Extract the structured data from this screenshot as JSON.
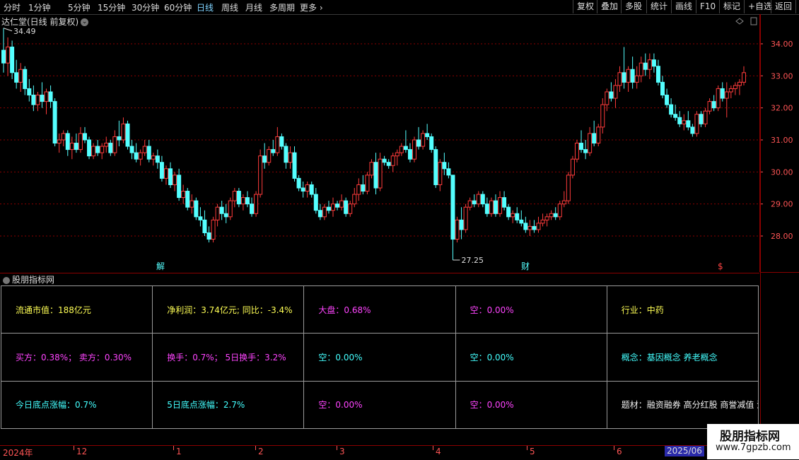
{
  "toolbar": {
    "periods": [
      "分时",
      "1分钟",
      "5分钟",
      "15分钟",
      "30分钟",
      "60分钟",
      "日线",
      "周线",
      "月线",
      "多周期",
      "更多"
    ],
    "right_buttons": [
      "复权",
      "叠加",
      "多股",
      "统计",
      "画线",
      "F10",
      "标记",
      "+自选",
      "返回"
    ]
  },
  "chart": {
    "title": "达仁堂(日线 前复权)",
    "y_ticks": [
      "34.00",
      "33.00",
      "32.00",
      "31.00",
      "30.00",
      "29.00",
      "28.00"
    ],
    "high_label": "34.49",
    "low_label": "27.25",
    "markers": {
      "jie": "解",
      "cai": "财",
      "dollar": "$"
    },
    "colors": {
      "up": "#ff3b3b",
      "down": "#54ffff",
      "grid": "#8b0000",
      "axis_text": "#ff5555"
    }
  },
  "candles": [
    {
      "o": 33.8,
      "h": 34.49,
      "l": 33.1,
      "c": 33.4
    },
    {
      "o": 33.4,
      "h": 34.2,
      "l": 33.0,
      "c": 33.9
    },
    {
      "o": 33.9,
      "h": 34.1,
      "l": 32.9,
      "c": 33.1
    },
    {
      "o": 33.1,
      "h": 33.5,
      "l": 32.6,
      "c": 32.8
    },
    {
      "o": 32.8,
      "h": 33.4,
      "l": 32.5,
      "c": 33.2
    },
    {
      "o": 33.2,
      "h": 33.3,
      "l": 32.4,
      "c": 32.6
    },
    {
      "o": 32.6,
      "h": 32.9,
      "l": 32.2,
      "c": 32.4
    },
    {
      "o": 32.4,
      "h": 32.7,
      "l": 31.9,
      "c": 32.1
    },
    {
      "o": 32.1,
      "h": 32.5,
      "l": 31.9,
      "c": 32.4
    },
    {
      "o": 32.4,
      "h": 32.8,
      "l": 32.0,
      "c": 32.2
    },
    {
      "o": 32.2,
      "h": 32.6,
      "l": 31.8,
      "c": 32.5
    },
    {
      "o": 32.5,
      "h": 32.7,
      "l": 32.0,
      "c": 32.2
    },
    {
      "o": 32.2,
      "h": 32.3,
      "l": 30.8,
      "c": 30.9
    },
    {
      "o": 30.9,
      "h": 31.2,
      "l": 30.6,
      "c": 31.0
    },
    {
      "o": 31.0,
      "h": 31.3,
      "l": 30.8,
      "c": 31.2
    },
    {
      "o": 31.2,
      "h": 31.3,
      "l": 30.5,
      "c": 30.7
    },
    {
      "o": 30.7,
      "h": 31.1,
      "l": 30.4,
      "c": 30.9
    },
    {
      "o": 30.9,
      "h": 31.2,
      "l": 30.6,
      "c": 30.7
    },
    {
      "o": 30.7,
      "h": 31.4,
      "l": 30.6,
      "c": 31.2
    },
    {
      "o": 31.2,
      "h": 31.4,
      "l": 30.9,
      "c": 31.0
    },
    {
      "o": 31.0,
      "h": 31.1,
      "l": 30.4,
      "c": 30.5
    },
    {
      "o": 30.5,
      "h": 30.9,
      "l": 30.4,
      "c": 30.8
    },
    {
      "o": 30.8,
      "h": 31.0,
      "l": 30.5,
      "c": 30.6
    },
    {
      "o": 30.6,
      "h": 30.9,
      "l": 30.4,
      "c": 30.8
    },
    {
      "o": 30.8,
      "h": 31.1,
      "l": 30.6,
      "c": 30.9
    },
    {
      "o": 30.9,
      "h": 31.0,
      "l": 30.5,
      "c": 30.6
    },
    {
      "o": 30.6,
      "h": 31.3,
      "l": 30.5,
      "c": 31.1
    },
    {
      "o": 31.1,
      "h": 31.6,
      "l": 30.8,
      "c": 31.0
    },
    {
      "o": 31.0,
      "h": 31.7,
      "l": 30.9,
      "c": 31.5
    },
    {
      "o": 31.5,
      "h": 31.6,
      "l": 30.7,
      "c": 30.8
    },
    {
      "o": 30.8,
      "h": 31.0,
      "l": 30.4,
      "c": 30.6
    },
    {
      "o": 30.6,
      "h": 30.9,
      "l": 30.3,
      "c": 30.4
    },
    {
      "o": 30.4,
      "h": 30.7,
      "l": 30.2,
      "c": 30.6
    },
    {
      "o": 30.6,
      "h": 31.0,
      "l": 30.5,
      "c": 30.8
    },
    {
      "o": 30.8,
      "h": 31.0,
      "l": 30.3,
      "c": 30.4
    },
    {
      "o": 30.4,
      "h": 30.6,
      "l": 30.2,
      "c": 30.5
    },
    {
      "o": 30.5,
      "h": 30.7,
      "l": 30.1,
      "c": 30.3
    },
    {
      "o": 30.3,
      "h": 30.5,
      "l": 29.7,
      "c": 29.8
    },
    {
      "o": 29.8,
      "h": 30.2,
      "l": 29.6,
      "c": 30.1
    },
    {
      "o": 30.1,
      "h": 30.3,
      "l": 29.5,
      "c": 29.6
    },
    {
      "o": 29.6,
      "h": 30.0,
      "l": 29.4,
      "c": 29.9
    },
    {
      "o": 29.9,
      "h": 30.1,
      "l": 29.1,
      "c": 29.2
    },
    {
      "o": 29.2,
      "h": 29.6,
      "l": 29.0,
      "c": 29.4
    },
    {
      "o": 29.4,
      "h": 29.5,
      "l": 28.8,
      "c": 28.9
    },
    {
      "o": 28.9,
      "h": 29.3,
      "l": 28.7,
      "c": 29.1
    },
    {
      "o": 29.1,
      "h": 29.2,
      "l": 28.5,
      "c": 28.6
    },
    {
      "o": 28.6,
      "h": 28.9,
      "l": 28.3,
      "c": 28.5
    },
    {
      "o": 28.5,
      "h": 28.8,
      "l": 28.0,
      "c": 28.1
    },
    {
      "o": 28.1,
      "h": 28.3,
      "l": 27.8,
      "c": 27.9
    },
    {
      "o": 27.9,
      "h": 28.6,
      "l": 27.8,
      "c": 28.5
    },
    {
      "o": 28.5,
      "h": 29.0,
      "l": 28.3,
      "c": 28.9
    },
    {
      "o": 28.9,
      "h": 29.1,
      "l": 28.5,
      "c": 28.7
    },
    {
      "o": 28.7,
      "h": 29.0,
      "l": 28.4,
      "c": 28.6
    },
    {
      "o": 28.6,
      "h": 29.2,
      "l": 28.5,
      "c": 29.1
    },
    {
      "o": 29.1,
      "h": 29.5,
      "l": 28.9,
      "c": 29.4
    },
    {
      "o": 29.4,
      "h": 29.5,
      "l": 28.9,
      "c": 29.0
    },
    {
      "o": 29.0,
      "h": 29.3,
      "l": 28.8,
      "c": 29.2
    },
    {
      "o": 29.2,
      "h": 29.4,
      "l": 28.9,
      "c": 29.0
    },
    {
      "o": 29.0,
      "h": 29.2,
      "l": 28.6,
      "c": 28.7
    },
    {
      "o": 28.7,
      "h": 29.4,
      "l": 28.6,
      "c": 29.3
    },
    {
      "o": 29.3,
      "h": 30.7,
      "l": 29.2,
      "c": 30.5
    },
    {
      "o": 30.5,
      "h": 30.9,
      "l": 30.1,
      "c": 30.3
    },
    {
      "o": 30.3,
      "h": 30.8,
      "l": 30.2,
      "c": 30.7
    },
    {
      "o": 30.7,
      "h": 31.0,
      "l": 30.5,
      "c": 30.6
    },
    {
      "o": 30.6,
      "h": 31.4,
      "l": 30.5,
      "c": 31.1
    },
    {
      "o": 31.1,
      "h": 31.2,
      "l": 30.7,
      "c": 30.8
    },
    {
      "o": 30.8,
      "h": 30.9,
      "l": 30.1,
      "c": 30.3
    },
    {
      "o": 30.3,
      "h": 30.8,
      "l": 30.1,
      "c": 30.6
    },
    {
      "o": 30.6,
      "h": 30.8,
      "l": 29.7,
      "c": 29.8
    },
    {
      "o": 29.8,
      "h": 29.9,
      "l": 29.4,
      "c": 29.5
    },
    {
      "o": 29.5,
      "h": 29.7,
      "l": 29.2,
      "c": 29.4
    },
    {
      "o": 29.4,
      "h": 29.7,
      "l": 29.2,
      "c": 29.6
    },
    {
      "o": 29.6,
      "h": 29.7,
      "l": 29.2,
      "c": 29.3
    },
    {
      "o": 29.3,
      "h": 29.5,
      "l": 28.7,
      "c": 28.8
    },
    {
      "o": 28.8,
      "h": 29.0,
      "l": 28.5,
      "c": 28.6
    },
    {
      "o": 28.6,
      "h": 29.0,
      "l": 28.5,
      "c": 28.9
    },
    {
      "o": 28.9,
      "h": 29.1,
      "l": 28.7,
      "c": 28.8
    },
    {
      "o": 28.8,
      "h": 29.2,
      "l": 28.6,
      "c": 29.0
    },
    {
      "o": 29.0,
      "h": 29.1,
      "l": 28.8,
      "c": 28.9
    },
    {
      "o": 28.9,
      "h": 29.3,
      "l": 28.8,
      "c": 29.1
    },
    {
      "o": 29.1,
      "h": 29.2,
      "l": 28.6,
      "c": 28.7
    },
    {
      "o": 28.7,
      "h": 29.1,
      "l": 28.6,
      "c": 29.0
    },
    {
      "o": 29.0,
      "h": 29.5,
      "l": 28.9,
      "c": 29.3
    },
    {
      "o": 29.3,
      "h": 29.8,
      "l": 29.1,
      "c": 29.6
    },
    {
      "o": 29.6,
      "h": 29.9,
      "l": 29.3,
      "c": 29.4
    },
    {
      "o": 29.4,
      "h": 30.0,
      "l": 29.3,
      "c": 29.9
    },
    {
      "o": 29.9,
      "h": 30.4,
      "l": 29.8,
      "c": 30.3
    },
    {
      "o": 30.3,
      "h": 30.6,
      "l": 29.3,
      "c": 29.5
    },
    {
      "o": 29.5,
      "h": 30.6,
      "l": 29.4,
      "c": 30.4
    },
    {
      "o": 30.4,
      "h": 30.5,
      "l": 30.2,
      "c": 30.3
    },
    {
      "o": 30.3,
      "h": 30.4,
      "l": 30.1,
      "c": 30.2
    },
    {
      "o": 30.2,
      "h": 30.6,
      "l": 30.0,
      "c": 30.5
    },
    {
      "o": 30.5,
      "h": 30.7,
      "l": 30.2,
      "c": 30.6
    },
    {
      "o": 30.6,
      "h": 30.9,
      "l": 30.5,
      "c": 30.8
    },
    {
      "o": 30.8,
      "h": 31.3,
      "l": 30.6,
      "c": 30.7
    },
    {
      "o": 30.7,
      "h": 30.9,
      "l": 30.3,
      "c": 30.4
    },
    {
      "o": 30.4,
      "h": 31.1,
      "l": 30.3,
      "c": 31.0
    },
    {
      "o": 31.0,
      "h": 31.4,
      "l": 30.7,
      "c": 30.8
    },
    {
      "o": 30.8,
      "h": 31.3,
      "l": 30.7,
      "c": 31.2
    },
    {
      "o": 31.2,
      "h": 31.5,
      "l": 31.0,
      "c": 31.1
    },
    {
      "o": 31.1,
      "h": 31.2,
      "l": 30.6,
      "c": 30.7
    },
    {
      "o": 30.7,
      "h": 30.8,
      "l": 29.5,
      "c": 29.6
    },
    {
      "o": 29.6,
      "h": 30.4,
      "l": 29.4,
      "c": 30.3
    },
    {
      "o": 30.3,
      "h": 30.6,
      "l": 29.9,
      "c": 30.1
    },
    {
      "o": 30.1,
      "h": 30.3,
      "l": 29.8,
      "c": 29.9
    },
    {
      "o": 29.9,
      "h": 29.9,
      "l": 27.25,
      "c": 27.9
    },
    {
      "o": 27.9,
      "h": 28.6,
      "l": 27.8,
      "c": 28.5
    },
    {
      "o": 28.5,
      "h": 28.9,
      "l": 27.9,
      "c": 28.2
    },
    {
      "o": 28.2,
      "h": 29.0,
      "l": 28.1,
      "c": 28.9
    },
    {
      "o": 28.9,
      "h": 29.2,
      "l": 28.8,
      "c": 29.1
    },
    {
      "o": 29.1,
      "h": 29.3,
      "l": 28.9,
      "c": 29.0
    },
    {
      "o": 29.0,
      "h": 29.4,
      "l": 28.9,
      "c": 29.3
    },
    {
      "o": 29.3,
      "h": 29.4,
      "l": 28.9,
      "c": 29.0
    },
    {
      "o": 29.0,
      "h": 29.2,
      "l": 28.6,
      "c": 28.7
    },
    {
      "o": 28.7,
      "h": 29.2,
      "l": 28.6,
      "c": 29.1
    },
    {
      "o": 29.1,
      "h": 29.3,
      "l": 28.6,
      "c": 28.7
    },
    {
      "o": 28.7,
      "h": 29.4,
      "l": 28.6,
      "c": 29.2
    },
    {
      "o": 29.2,
      "h": 29.4,
      "l": 28.8,
      "c": 28.9
    },
    {
      "o": 28.9,
      "h": 29.0,
      "l": 28.5,
      "c": 28.6
    },
    {
      "o": 28.6,
      "h": 28.8,
      "l": 28.4,
      "c": 28.7
    },
    {
      "o": 28.7,
      "h": 28.9,
      "l": 28.4,
      "c": 28.5
    },
    {
      "o": 28.5,
      "h": 28.8,
      "l": 28.3,
      "c": 28.4
    },
    {
      "o": 28.4,
      "h": 28.6,
      "l": 28.1,
      "c": 28.2
    },
    {
      "o": 28.2,
      "h": 28.5,
      "l": 28.0,
      "c": 28.3
    },
    {
      "o": 28.3,
      "h": 28.5,
      "l": 28.1,
      "c": 28.2
    },
    {
      "o": 28.2,
      "h": 28.6,
      "l": 28.1,
      "c": 28.4
    },
    {
      "o": 28.4,
      "h": 28.7,
      "l": 28.3,
      "c": 28.5
    },
    {
      "o": 28.5,
      "h": 28.7,
      "l": 28.3,
      "c": 28.6
    },
    {
      "o": 28.6,
      "h": 28.8,
      "l": 28.5,
      "c": 28.7
    },
    {
      "o": 28.7,
      "h": 28.9,
      "l": 28.5,
      "c": 28.6
    },
    {
      "o": 28.6,
      "h": 29.1,
      "l": 28.5,
      "c": 29.0
    },
    {
      "o": 29.0,
      "h": 29.4,
      "l": 28.9,
      "c": 29.1
    },
    {
      "o": 29.1,
      "h": 30.0,
      "l": 29.0,
      "c": 29.9
    },
    {
      "o": 29.9,
      "h": 30.5,
      "l": 29.8,
      "c": 30.4
    },
    {
      "o": 30.4,
      "h": 31.0,
      "l": 30.3,
      "c": 30.9
    },
    {
      "o": 30.9,
      "h": 31.3,
      "l": 30.6,
      "c": 30.7
    },
    {
      "o": 30.7,
      "h": 31.0,
      "l": 30.4,
      "c": 30.6
    },
    {
      "o": 30.6,
      "h": 31.4,
      "l": 30.5,
      "c": 31.2
    },
    {
      "o": 31.2,
      "h": 31.6,
      "l": 30.8,
      "c": 30.9
    },
    {
      "o": 30.9,
      "h": 31.5,
      "l": 30.8,
      "c": 31.4
    },
    {
      "o": 31.4,
      "h": 32.3,
      "l": 31.2,
      "c": 32.1
    },
    {
      "o": 32.1,
      "h": 32.6,
      "l": 31.9,
      "c": 32.5
    },
    {
      "o": 32.5,
      "h": 32.8,
      "l": 32.2,
      "c": 32.3
    },
    {
      "o": 32.3,
      "h": 32.9,
      "l": 32.0,
      "c": 32.7
    },
    {
      "o": 32.7,
      "h": 33.3,
      "l": 32.5,
      "c": 33.1
    },
    {
      "o": 33.1,
      "h": 33.9,
      "l": 32.6,
      "c": 32.8
    },
    {
      "o": 32.8,
      "h": 33.3,
      "l": 32.5,
      "c": 33.2
    },
    {
      "o": 33.2,
      "h": 33.6,
      "l": 32.6,
      "c": 32.8
    },
    {
      "o": 32.8,
      "h": 33.3,
      "l": 32.6,
      "c": 33.0
    },
    {
      "o": 33.0,
      "h": 33.6,
      "l": 32.8,
      "c": 33.4
    },
    {
      "o": 33.4,
      "h": 33.7,
      "l": 33.0,
      "c": 33.2
    },
    {
      "o": 33.2,
      "h": 33.7,
      "l": 32.9,
      "c": 33.5
    },
    {
      "o": 33.5,
      "h": 33.7,
      "l": 33.1,
      "c": 33.3
    },
    {
      "o": 33.3,
      "h": 33.5,
      "l": 32.7,
      "c": 32.8
    },
    {
      "o": 32.8,
      "h": 33.0,
      "l": 32.3,
      "c": 32.4
    },
    {
      "o": 32.4,
      "h": 32.6,
      "l": 32.0,
      "c": 32.1
    },
    {
      "o": 32.1,
      "h": 32.3,
      "l": 31.7,
      "c": 31.8
    },
    {
      "o": 31.8,
      "h": 32.1,
      "l": 31.6,
      "c": 31.7
    },
    {
      "o": 31.7,
      "h": 31.9,
      "l": 31.4,
      "c": 31.5
    },
    {
      "o": 31.5,
      "h": 31.8,
      "l": 31.3,
      "c": 31.6
    },
    {
      "o": 31.6,
      "h": 31.9,
      "l": 31.3,
      "c": 31.4
    },
    {
      "o": 31.4,
      "h": 31.5,
      "l": 31.1,
      "c": 31.2
    },
    {
      "o": 31.2,
      "h": 31.9,
      "l": 31.1,
      "c": 31.8
    },
    {
      "o": 31.8,
      "h": 31.9,
      "l": 31.4,
      "c": 31.5
    },
    {
      "o": 31.5,
      "h": 32.0,
      "l": 31.4,
      "c": 31.9
    },
    {
      "o": 31.9,
      "h": 32.3,
      "l": 31.8,
      "c": 32.2
    },
    {
      "o": 32.2,
      "h": 32.4,
      "l": 31.9,
      "c": 32.0
    },
    {
      "o": 32.0,
      "h": 32.7,
      "l": 31.9,
      "c": 32.6
    },
    {
      "o": 32.6,
      "h": 32.8,
      "l": 32.2,
      "c": 32.3
    },
    {
      "o": 32.3,
      "h": 32.8,
      "l": 31.7,
      "c": 32.5
    },
    {
      "o": 32.5,
      "h": 32.7,
      "l": 32.3,
      "c": 32.6
    },
    {
      "o": 32.6,
      "h": 32.8,
      "l": 32.4,
      "c": 32.7
    },
    {
      "o": 32.7,
      "h": 32.9,
      "l": 32.4,
      "c": 32.8
    },
    {
      "o": 32.8,
      "h": 33.3,
      "l": 32.7,
      "c": 33.1
    }
  ],
  "indicator": {
    "title": "股朋指标网",
    "rows": [
      [
        {
          "text": "流通市值：188亿元",
          "color": "yellow"
        },
        {
          "text": "净利润：3.74亿元;  同比：-3.4%",
          "color": "yellow"
        },
        {
          "text": "大盘：0.68%",
          "color": "magenta"
        },
        {
          "text": "空：0.00%",
          "color": "magenta"
        },
        {
          "text": "行业：中药",
          "color": "yellow"
        }
      ],
      [
        {
          "text": "买方：0.38%；  卖方：0.30%",
          "color": "magenta"
        },
        {
          "text": "换手：0.7%；  5日换手：3.2%",
          "color": "magenta"
        },
        {
          "text": "空：0.00%",
          "color": "cyan"
        },
        {
          "text": "空：0.00%",
          "color": "cyan"
        },
        {
          "text": "概念：基因概念 养老概念",
          "color": "cyan"
        }
      ],
      [
        {
          "text": "今日底点涨幅：0.7%",
          "color": "cyan"
        },
        {
          "text": "5日底点涨幅：2.7%",
          "color": "cyan"
        },
        {
          "text": "空：0.00%",
          "color": "magenta"
        },
        {
          "text": "空：0.00%",
          "color": "magenta"
        },
        {
          "text": "题材：融资融券 高分红股 商誉减值 沪",
          "color": "white"
        }
      ]
    ]
  },
  "time_axis": {
    "labels": [
      "2024年",
      "12",
      "1",
      "2",
      "3",
      "4",
      "5",
      "6"
    ],
    "current": "2025/06"
  },
  "watermark": {
    "main": "股朋指标网",
    "url": "www.7gpzb.com"
  }
}
